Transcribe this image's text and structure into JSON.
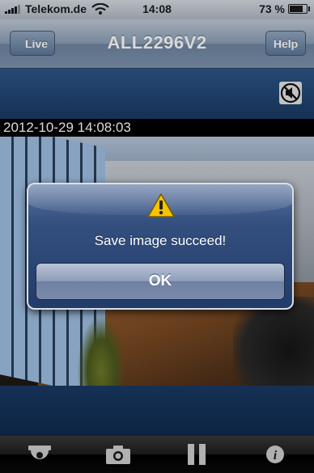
{
  "status_bar": {
    "carrier": "Telekom.de",
    "time": "14:08",
    "battery": "73 %",
    "battery_level": 0.73,
    "signal_icon": "signal-bars-icon",
    "wifi_icon": "wifi-icon",
    "battery_icon": "battery-icon"
  },
  "nav": {
    "back_label": "Live",
    "title": "ALL2296V2",
    "help_label": "Help"
  },
  "camera": {
    "mute_icon": "speaker-muted-icon",
    "timestamp": "2012-10-29 14:08:03"
  },
  "alert": {
    "icon": "warning-icon",
    "message": "Save image succeed!",
    "ok_label": "OK"
  },
  "toolbar": {
    "items": [
      {
        "icon": "ptz-camera-icon"
      },
      {
        "icon": "camera-icon"
      },
      {
        "icon": "pause-icon"
      },
      {
        "icon": "info-icon"
      }
    ]
  },
  "colors": {
    "nav_bar": "#7d93ad",
    "video_background": "#1a3a64",
    "alert_background": "#34507f",
    "toolbar": "#1d1d1d",
    "warning": "#f5c400"
  }
}
